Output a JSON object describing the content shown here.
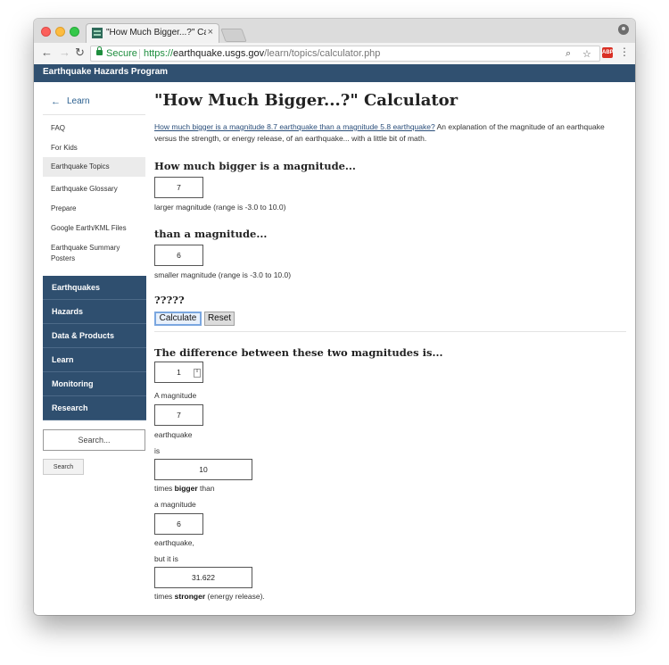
{
  "browser": {
    "tab_title": "\"How Much Bigger...?\" Calcula",
    "tab_close": "×",
    "secure_label": "Secure",
    "url_protocol": "https://",
    "url_host": "earthquake.usgs.gov",
    "url_path": "/learn/topics/calculator.php",
    "ext_label": "ABP"
  },
  "banner": {
    "title": "Earthquake Hazards Program"
  },
  "sidebar": {
    "back": {
      "arrow": "←",
      "label": "Learn"
    },
    "links": [
      {
        "line1": "FAQ",
        "line2": ""
      },
      {
        "line1": "For Kids",
        "line2": ""
      },
      {
        "line1": "Earthquake Topics",
        "line2": ""
      },
      {
        "line1": "Earthquake Glossary",
        "line2": ""
      },
      {
        "line1": "Prepare",
        "line2": ""
      },
      {
        "line1": "Google Earth/KML Files",
        "line2": ""
      },
      {
        "line1": "Earthquake Summary",
        "line2": "Posters"
      }
    ],
    "nav": [
      "Earthquakes",
      "Hazards",
      "Data & Products",
      "Learn",
      "Monitoring",
      "Research"
    ],
    "search_placeholder": "Search...",
    "search_button": "Search"
  },
  "main": {
    "title": "\"How Much Bigger...?\" Calculator",
    "intro_link": "How much bigger is a magnitude 8.7 earthquake than a magnitude 5.8 earthquake?",
    "intro_text": " An explanation of the magnitude of an earthquake versus the strength, or energy release, of an earthquake... with a little bit of math.",
    "q1_heading": "How much bigger is a magnitude...",
    "q1_value": "7",
    "q1_caption": "larger magnitude (range is -3.0 to 10.0)",
    "q2_heading": "than a magnitude...",
    "q2_value": "6",
    "q2_caption": "smaller magnitude (range is -3.0 to 10.0)",
    "q3_heading": "?????",
    "calc_button": "Calculate",
    "reset_button": "Reset",
    "result_heading": "The difference between these two magnitudes is...",
    "diff_value": "1",
    "spin_glyph": "⇕",
    "a_magnitude": "A magnitude",
    "mag_large": "7",
    "earthquake": "earthquake",
    "is": "is",
    "bigger_value": "10",
    "times_prefix": "times ",
    "bigger_word": "bigger",
    "than_suffix": " than",
    "a_magnitude2": "a magnitude",
    "mag_small": "6",
    "earthquake_comma": "earthquake,",
    "but_it_is": "but it is",
    "stronger_value": "31.622",
    "stronger_word": "stronger",
    "energy_suffix": " (energy release)."
  }
}
